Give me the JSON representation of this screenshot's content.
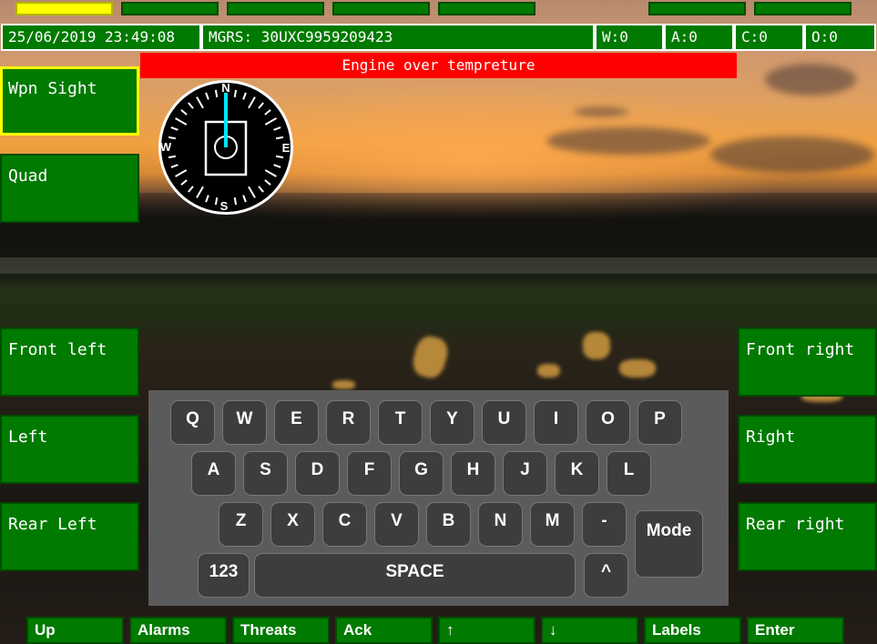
{
  "status": {
    "datetime": "25/06/2019 23:49:08",
    "mgrs": "MGRS: 30UXC9959209423",
    "w": "W:0",
    "a": "A:0",
    "c": "C:0",
    "o": "O:0"
  },
  "alarm": {
    "text": "Engine over tempreture",
    "color": "#ff0000"
  },
  "left_buttons": [
    "Wpn Sight",
    "Quad",
    "Front left",
    "Left",
    "Rear Left"
  ],
  "right_buttons": [
    "Front right",
    "Right",
    "Rear right"
  ],
  "compass": {
    "n": "N",
    "s": "S",
    "e": "E",
    "w": "W",
    "heading_deg": 0
  },
  "keyboard": {
    "row1": [
      "Q",
      "W",
      "E",
      "R",
      "T",
      "Y",
      "U",
      "I",
      "O",
      "P"
    ],
    "row2": [
      "A",
      "S",
      "D",
      "F",
      "G",
      "H",
      "J",
      "K",
      "L"
    ],
    "row3": [
      "Z",
      "X",
      "C",
      "V",
      "B",
      "N",
      "M",
      "-"
    ],
    "mode": "Mode",
    "num": "123",
    "space": "SPACE",
    "caret": "^"
  },
  "bottom_buttons": [
    "Up",
    "Alarms",
    "Threats",
    "Ack",
    "↑",
    "↓",
    "Labels",
    "Enter"
  ],
  "colors": {
    "button_green": "#007a00",
    "selected": "#ffff00",
    "alarm_red": "#ff0000",
    "needle": "#00e5ff"
  }
}
